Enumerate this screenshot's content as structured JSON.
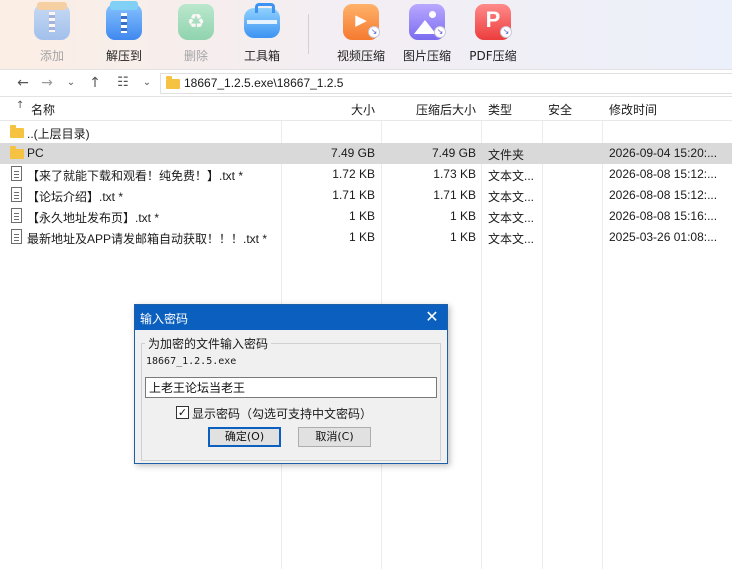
{
  "toolbar": {
    "buttons": [
      {
        "label": "添加",
        "icon": "add-archive-icon",
        "enabled": false
      },
      {
        "label": "解压到",
        "icon": "extract-icon",
        "enabled": true
      },
      {
        "label": "删除",
        "icon": "recycle-delete-icon",
        "enabled": false
      },
      {
        "label": "工具箱",
        "icon": "toolbox-icon",
        "enabled": true
      },
      {
        "label": "视频压缩",
        "icon": "video-compress-icon",
        "enabled": true
      },
      {
        "label": "图片压缩",
        "icon": "image-compress-icon",
        "enabled": true
      },
      {
        "label": "PDF压缩",
        "icon": "pdf-compress-icon",
        "enabled": true
      }
    ]
  },
  "addressbar": {
    "path": "18667_1.2.5.exe\\18667_1.2.5"
  },
  "filelist": {
    "headers": {
      "name": "名称",
      "size": "大小",
      "packed": "压缩后大小",
      "type": "类型",
      "security": "安全",
      "modified": "修改时间"
    },
    "rows": [
      {
        "icon": "folder",
        "name": "..(上层目录)",
        "size": "",
        "packed": "",
        "type": "",
        "security": "",
        "modified": "",
        "selected": false
      },
      {
        "icon": "folder",
        "name": "PC",
        "size": "7.49 GB",
        "packed": "7.49 GB",
        "type": "文件夹",
        "security": "",
        "modified": "2026-09-04 15:20:...",
        "selected": true
      },
      {
        "icon": "document",
        "name": "【来了就能下载和观看！纯免费！】.txt *",
        "size": "1.72 KB",
        "packed": "1.73 KB",
        "type": "文本文...",
        "security": "",
        "modified": "2026-08-08 15:12:...",
        "selected": false
      },
      {
        "icon": "document",
        "name": "【论坛介绍】.txt *",
        "size": "1.71 KB",
        "packed": "1.71 KB",
        "type": "文本文...",
        "security": "",
        "modified": "2026-08-08 15:12:...",
        "selected": false
      },
      {
        "icon": "document",
        "name": "【永久地址发布页】.txt *",
        "size": "1 KB",
        "packed": "1 KB",
        "type": "文本文...",
        "security": "",
        "modified": "2026-08-08 15:16:...",
        "selected": false
      },
      {
        "icon": "document",
        "name": "最新地址及APP请发邮箱自动获取！！！.txt *",
        "size": "1 KB",
        "packed": "1 KB",
        "type": "文本文...",
        "security": "",
        "modified": "2025-03-26 01:08:...",
        "selected": false
      }
    ]
  },
  "dialog": {
    "title": "输入密码",
    "group_label": "为加密的文件输入密码",
    "filename": "18667_1.2.5.exe",
    "password_value": "上老王论坛当老王",
    "show_password_label": "显示密码（勾选可支持中文密码）",
    "show_password_checked": true,
    "ok_label": "确定(O)",
    "cancel_label": "取消(C)"
  },
  "colors": {
    "selected_row": "#d9d9d9",
    "dialog_title_bar": "#0b5fbf",
    "folder": "#f5c341"
  }
}
